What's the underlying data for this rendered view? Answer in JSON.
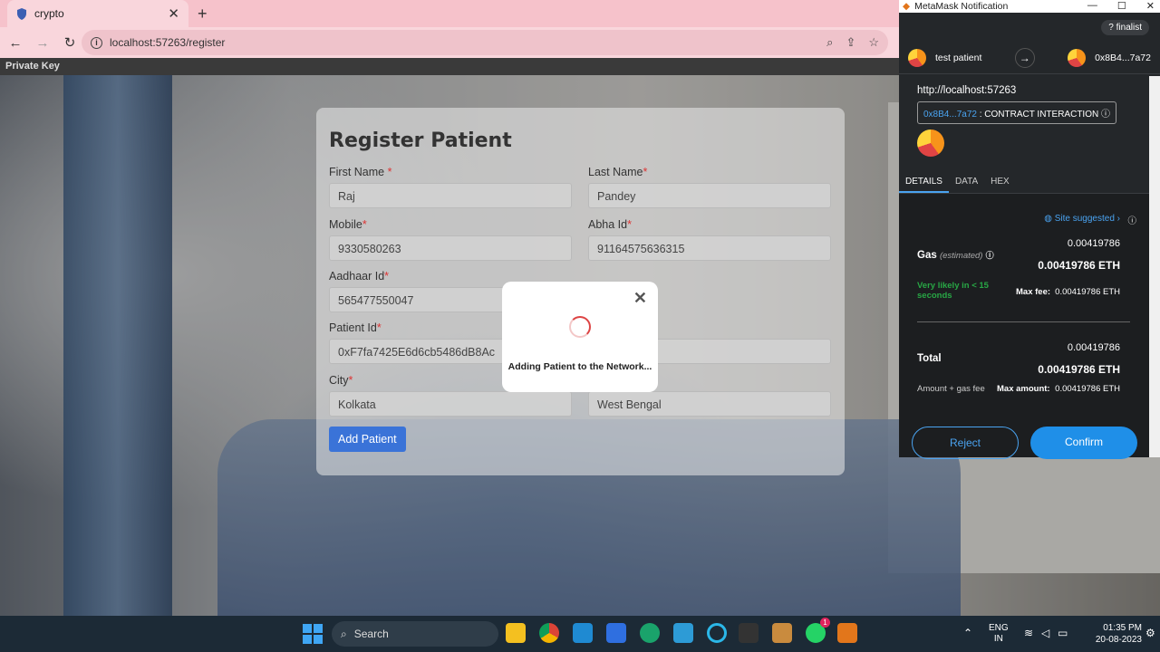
{
  "browser": {
    "tab_title": "crypto",
    "url": "localhost:57263/register",
    "bookmark": "Private Key"
  },
  "form": {
    "title": "Register Patient",
    "fields": [
      {
        "label": "First Name",
        "required": "*",
        "value": "Raj"
      },
      {
        "label": "Last Name",
        "required": "*",
        "value": "Pandey"
      },
      {
        "label": "Mobile",
        "required": "*",
        "value": "9330580263"
      },
      {
        "label": "Abha Id",
        "required": "*",
        "value": "91164575636315"
      },
      {
        "label": "Aadhaar Id",
        "required": "*",
        "value": "565477550047"
      },
      {
        "label": "Patient Id",
        "required": "*",
        "value": "0xF7fa7425E6d6cb5486dB8Ac"
      },
      {
        "label": "City",
        "required": "*",
        "value": "Kolkata"
      },
      {
        "label": "",
        "required": "",
        "value": "West Bengal"
      }
    ],
    "submit": "Add Patient"
  },
  "modal": {
    "message": "Adding Patient to the Network...",
    "close": "✕"
  },
  "metamask": {
    "window_title": "MetaMask Notification",
    "network": "finalist",
    "from_account": "test patient",
    "to_account": "0x8B4...7a72",
    "origin": "http://localhost:57263",
    "contract_addr": "0x8B4...7a72",
    "contract_label": ": CONTRACT INTERACTION",
    "tabs": [
      "DETAILS",
      "DATA",
      "HEX"
    ],
    "site_suggested": "Site suggested",
    "gas_label": "Gas",
    "gas_estimated": "(estimated)",
    "gas_value": "0.00419786",
    "gas_eth": "0.00419786 ETH",
    "likely": "Very likely in < 15 seconds",
    "max_fee_label": "Max fee:",
    "max_fee": "0.00419786 ETH",
    "total_label": "Total",
    "total_value": "0.00419786",
    "total_eth": "0.00419786 ETH",
    "amount_gas": "Amount + gas fee",
    "max_amount_label": "Max amount:",
    "max_amount": "0.00419786 ETH",
    "reject": "Reject",
    "confirm": "Confirm"
  },
  "taskbar": {
    "search": "Search",
    "lang1": "ENG",
    "lang2": "IN",
    "time": "01:35 PM",
    "date": "20-08-2023",
    "whatsapp_badge": "1"
  }
}
